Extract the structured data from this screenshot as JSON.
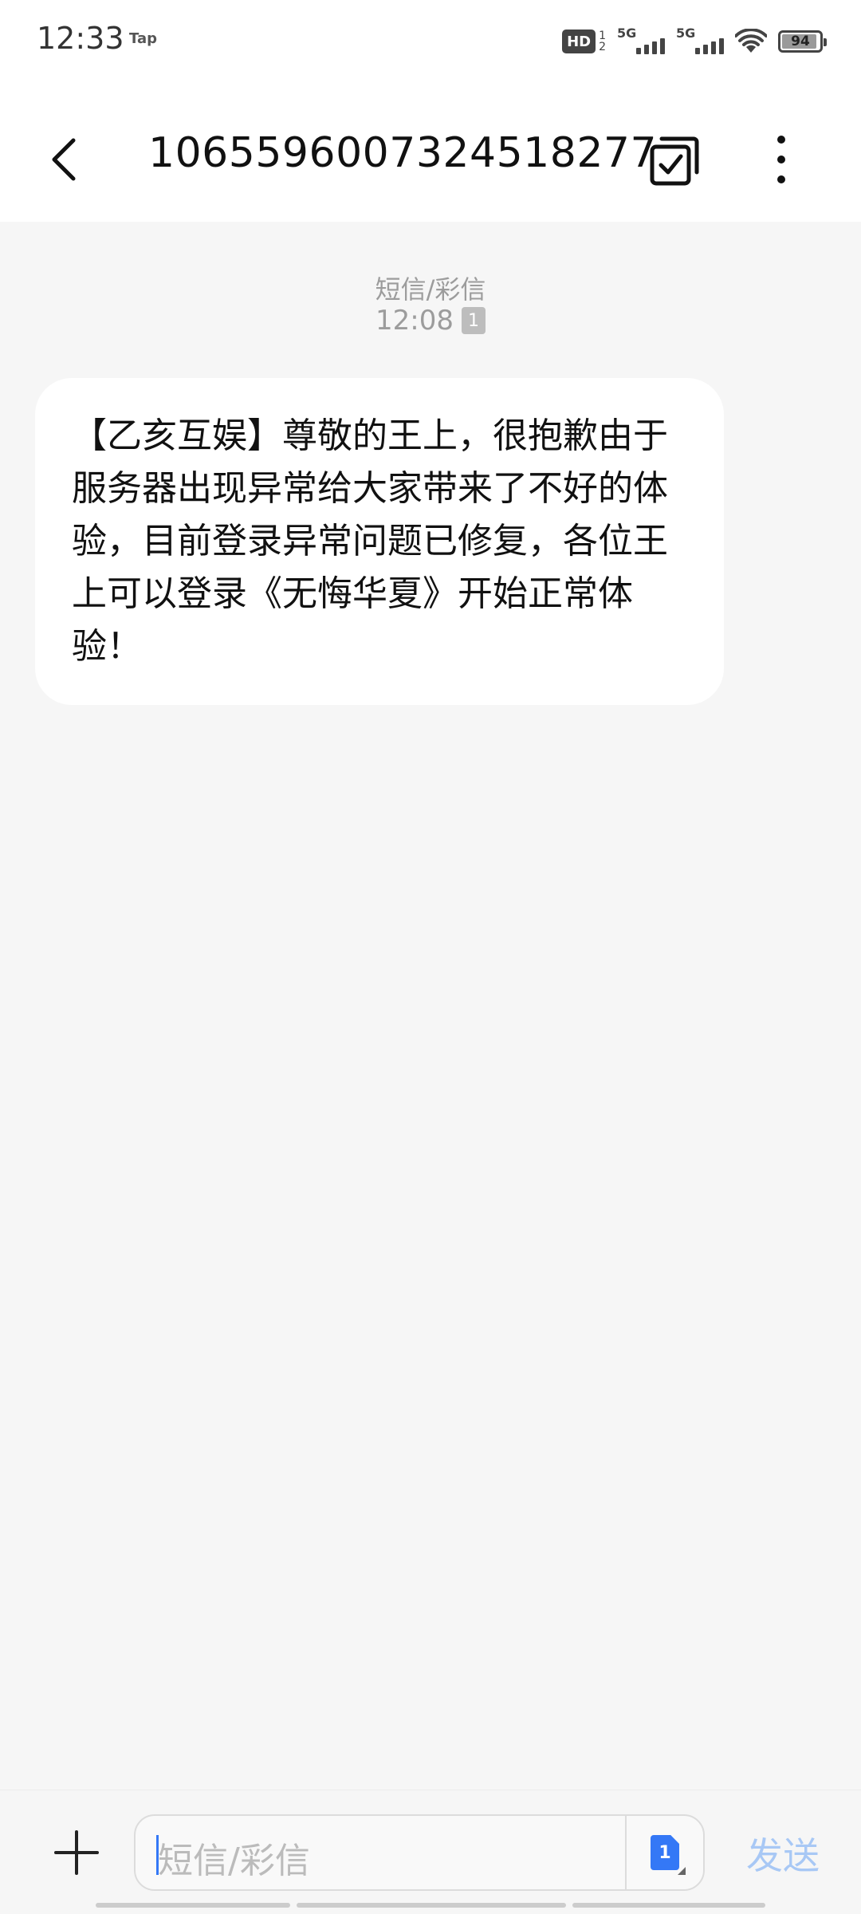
{
  "status_bar": {
    "time": "12:33",
    "app_label": "Tap",
    "hd_label": "HD",
    "hd_sim_top": "1",
    "hd_sim_bottom": "2",
    "sim1_network": "5G",
    "sim2_network": "5G",
    "battery_level": "94",
    "icons": [
      "hd-voice-icon",
      "signal-5g-icon",
      "signal-5g-icon",
      "wifi-icon",
      "battery-icon"
    ]
  },
  "header": {
    "contact_number": "1065596007324518277",
    "icons": [
      "back-arrow-icon",
      "multi-select-icon",
      "more-options-icon"
    ]
  },
  "conversation": {
    "message_type": "短信/彩信",
    "timestamp": "12:08",
    "sim_slot": "1",
    "messages": [
      {
        "text": "【乙亥互娱】尊敬的王上，很抱歉由于服务器出现异常给大家带来了不好的体验，目前登录异常问题已修复，各位王上可以登录《无悔华夏》开始正常体验！"
      }
    ]
  },
  "input_bar": {
    "placeholder": "短信/彩信",
    "sim_slot": "1",
    "send_label": "发送",
    "icons": [
      "plus-icon",
      "sim-card-icon"
    ]
  },
  "colors": {
    "accent": "#3478f6",
    "send_disabled": "#a8c8f5",
    "background": "#f6f6f6",
    "bubble": "#ffffff",
    "meta_text": "#9c9c9c"
  }
}
